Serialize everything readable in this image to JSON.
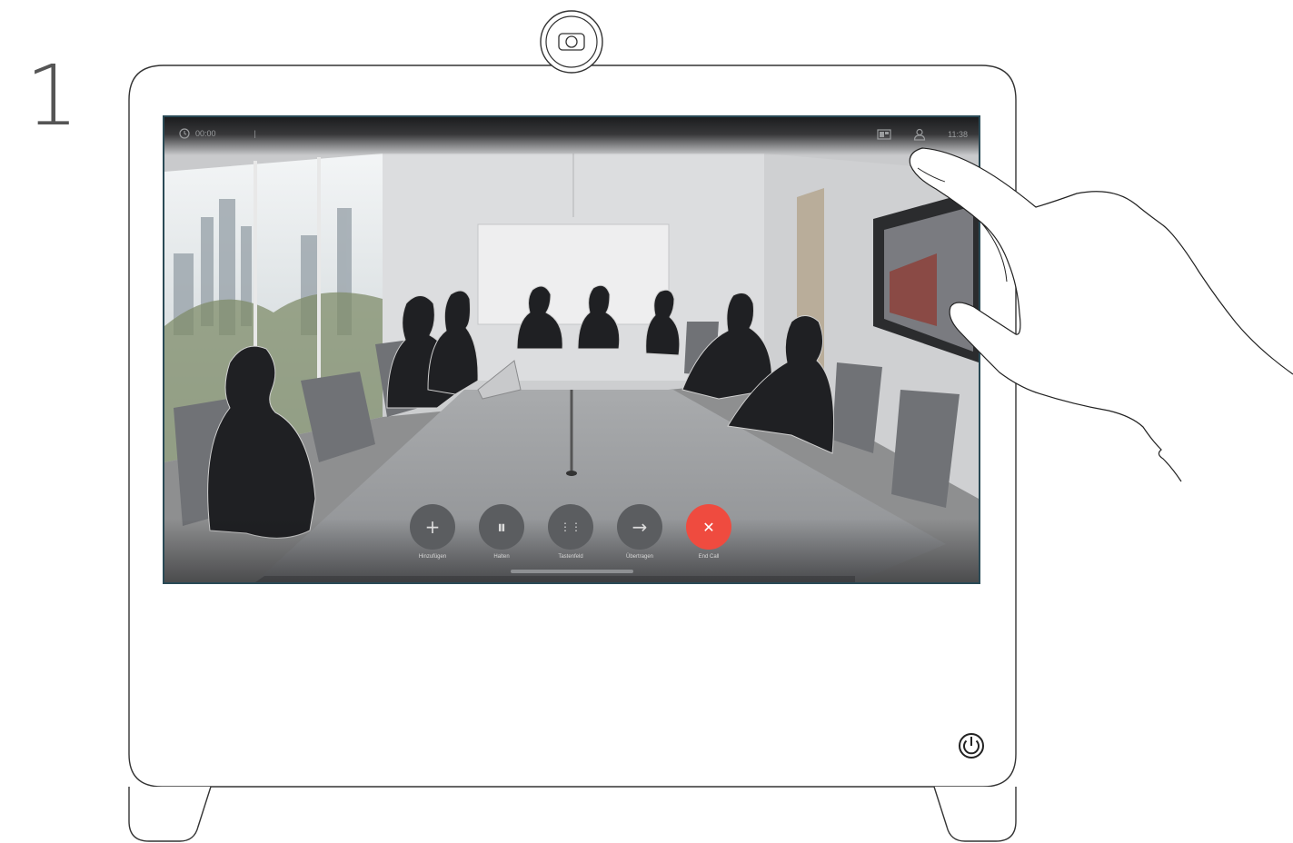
{
  "step": {
    "number": "1"
  },
  "call_screen": {
    "status_bar": {
      "left_icon": "clock-icon",
      "duration_text": "00:00",
      "separator_text": "|",
      "layout_icon": "layout-icon",
      "participants_icon": "person-icon",
      "time": "11:38"
    },
    "controls": [
      {
        "id": "add",
        "label": "Hinzufügen",
        "icon": "plus-icon",
        "glyph": "+"
      },
      {
        "id": "hold",
        "label": "Halten",
        "icon": "pause-icon",
        "glyph": "⏸"
      },
      {
        "id": "keypad",
        "label": "Tastenfeld",
        "icon": "keypad-icon",
        "glyph": "⋮⋮"
      },
      {
        "id": "transfer",
        "label": "Übertragen",
        "icon": "arrow-right-icon",
        "glyph": "→"
      },
      {
        "id": "end",
        "label": "End Call",
        "icon": "close-icon",
        "glyph": "✕"
      }
    ],
    "colors": {
      "end_call": "#ef4b3f",
      "control_button": "#5b5d60",
      "status_bar": "#1c1d1f"
    }
  },
  "device": {
    "camera_icon": "camera-icon",
    "power_icon": "power-icon"
  },
  "hand": {
    "icon": "hand-pointer-icon"
  }
}
